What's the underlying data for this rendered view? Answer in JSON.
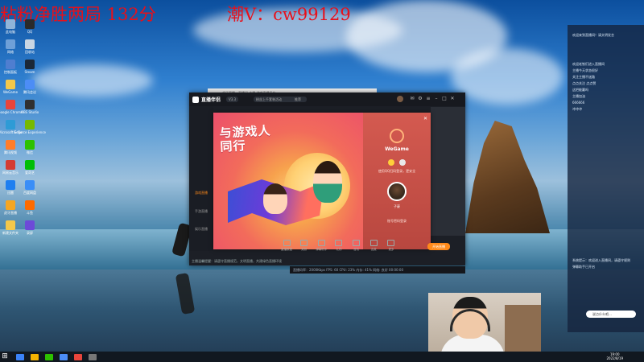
{
  "overlay": {
    "left_text": "粘粉净胜两局 132分",
    "right_text": "潮V：cw99129"
  },
  "desktop_icons": [
    {
      "label": "此电脑",
      "color": "#8fb4d9"
    },
    {
      "label": "QQ",
      "color": "#2a2a2a"
    },
    {
      "label": "网络",
      "color": "#6fa0d8"
    },
    {
      "label": "回收站",
      "color": "#c9d6e3"
    },
    {
      "label": "控制面板",
      "color": "#4f7ed0"
    },
    {
      "label": "Steam",
      "color": "#1b2838"
    },
    {
      "label": "WeGame",
      "color": "#f3c84b"
    },
    {
      "label": "腾讯会议",
      "color": "#4c8df6"
    },
    {
      "label": "Google Chrome",
      "color": "#e8453c"
    },
    {
      "label": "OBS Studio",
      "color": "#303030"
    },
    {
      "label": "Microsoft Edge",
      "color": "#2e9bd6"
    },
    {
      "label": "GeForce Experience",
      "color": "#76b900"
    },
    {
      "label": "腾讯视频",
      "color": "#ff7d2a"
    },
    {
      "label": "微信",
      "color": "#2dc100"
    },
    {
      "label": "网易云音乐",
      "color": "#d43c33"
    },
    {
      "label": "爱奇艺",
      "color": "#00be06"
    },
    {
      "label": "迅雷",
      "color": "#1f7ff0"
    },
    {
      "label": "百度网盘",
      "color": "#3a8ef7"
    },
    {
      "label": "虎牙直播",
      "color": "#f5a623"
    },
    {
      "label": "斗鱼",
      "color": "#ff6b00"
    },
    {
      "label": "新建文件夹",
      "color": "#f3c84b"
    },
    {
      "label": "录屏",
      "color": "#6d4ad8"
    }
  ],
  "taskbar": {
    "start_glyph": "⊞",
    "apps": [
      "#3b82f6",
      "#f5b400",
      "#2dc100",
      "#4c8df6",
      "#e8453c",
      "#777777"
    ],
    "time": "19:00",
    "date": "2022/8/19"
  },
  "browser_back": {
    "title": "虎牙直播 - 直播间 主播 游戏直播平台"
  },
  "app": {
    "name": "直播伴侣",
    "version_badge": "V3.3",
    "search_pill": "粉丝上千套装活动",
    "rec_pill": "推荐",
    "left_items": [
      "游戏直播",
      "手游直播",
      "娱乐直播",
      "录屏",
      "设置"
    ],
    "tools": [
      "直播数据",
      "美颜",
      "弹幕助手",
      "礼物",
      "音效",
      "连麦",
      "更多"
    ],
    "start_button": "开始直播",
    "notice": "主播温馨提醒：请遵守直播规范，文明直播，共建绿色直播环境",
    "status": "直播码率：2000Kbps  FPS: 60  CPU: 23%  内存: 41%  网络: 良好  00:00:00"
  },
  "popup": {
    "banner_line1": "与游戏人",
    "banner_line2": "同行",
    "login_brand": "WeGame",
    "login_hint": "使用QQ扫码登录，更安全",
    "avatar_name": "子豪",
    "login_footer": "账号密码登录",
    "close": "✕"
  },
  "chat_panel": {
    "messages": [
      "欢迎来到直播间！请文明发言",
      "欢迎老铁们进入直播间",
      "主播今天状态很好",
      "关注主播不迷路",
      "点点关注 点点赞",
      "这把能赢吗",
      "主播加油",
      "666666",
      "冲冲冲"
    ],
    "lower_messages": [
      "系统提示：欢迎进入直播间，请遵守规则",
      "弹幕助手已开启"
    ],
    "input_placeholder": "说点什么吧…"
  }
}
